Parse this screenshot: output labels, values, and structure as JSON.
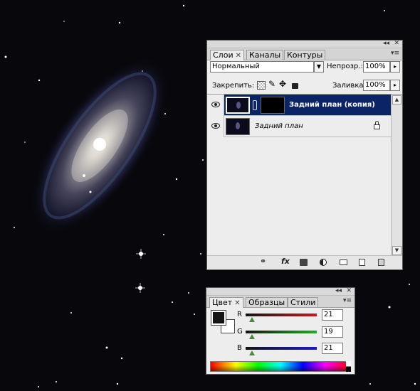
{
  "layers_panel": {
    "tabs": [
      {
        "label": "Слои",
        "close": "✕"
      },
      {
        "label": "Каналы"
      },
      {
        "label": "Контуры"
      }
    ],
    "blend_mode": "Нормальный",
    "opacity_label": "Непрозр.:",
    "opacity_value": "100%",
    "lock_label": "Закрепить:",
    "fill_label": "Заливка:",
    "fill_value": "100%",
    "layers": [
      {
        "name": "Задний план (копия)",
        "selected": true,
        "has_mask": true
      },
      {
        "name": "Задний план",
        "selected": false,
        "locked": true
      }
    ],
    "bottom_icons": [
      "link-icon",
      "fx-icon",
      "mask-icon",
      "adjustment-icon",
      "folder-icon",
      "new-layer-icon",
      "trash-icon"
    ],
    "fx_label": "fx"
  },
  "color_panel": {
    "tabs": [
      {
        "label": "Цвет",
        "close": "✕"
      },
      {
        "label": "Образцы"
      },
      {
        "label": "Стили"
      }
    ],
    "channels": [
      {
        "label": "R",
        "value": "21",
        "color": "#c61b1b"
      },
      {
        "label": "G",
        "value": "19",
        "color": "#1bb31b"
      },
      {
        "label": "B",
        "value": "21",
        "color": "#1b1bc6"
      }
    ],
    "foreground": "#151315",
    "background": "#ffffff"
  },
  "window_controls": {
    "collapse": "◂◂",
    "close": "✕",
    "menu": "▾≡"
  }
}
